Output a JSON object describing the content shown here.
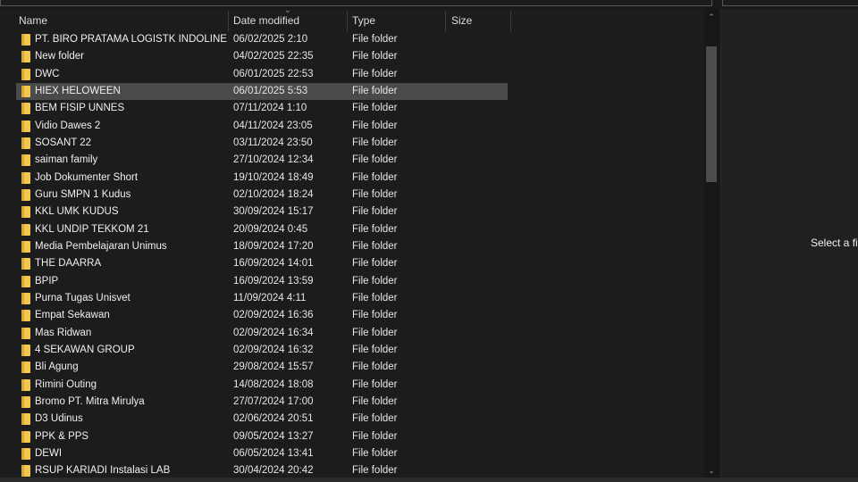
{
  "columns": {
    "name": "Name",
    "date": "Date modified",
    "type": "Type",
    "size": "Size"
  },
  "selected_index": 3,
  "rows": [
    {
      "name": "PT. BIRO PRATAMA LOGISTK INDOLINE",
      "date": "06/02/2025 2:10",
      "type": "File folder"
    },
    {
      "name": "New folder",
      "date": "04/02/2025 22:35",
      "type": "File folder"
    },
    {
      "name": "DWC",
      "date": "06/01/2025 22:53",
      "type": "File folder"
    },
    {
      "name": "HIEX HELOWEEN",
      "date": "06/01/2025 5:53",
      "type": "File folder"
    },
    {
      "name": "BEM FISIP UNNES",
      "date": "07/11/2024 1:10",
      "type": "File folder"
    },
    {
      "name": "Vidio Dawes 2",
      "date": "04/11/2024 23:05",
      "type": "File folder"
    },
    {
      "name": "SOSANT 22",
      "date": "03/11/2024 23:50",
      "type": "File folder"
    },
    {
      "name": "saiman family",
      "date": "27/10/2024 12:34",
      "type": "File folder"
    },
    {
      "name": "Job Dokumenter Short",
      "date": "19/10/2024 18:49",
      "type": "File folder"
    },
    {
      "name": "Guru SMPN 1 Kudus",
      "date": "02/10/2024 18:24",
      "type": "File folder"
    },
    {
      "name": "KKL UMK KUDUS",
      "date": "30/09/2024 15:17",
      "type": "File folder"
    },
    {
      "name": "KKL UNDIP TEKKOM 21",
      "date": "20/09/2024 0:45",
      "type": "File folder"
    },
    {
      "name": "Media Pembelajaran Unimus",
      "date": "18/09/2024 17:20",
      "type": "File folder"
    },
    {
      "name": "THE DAARRA",
      "date": "16/09/2024 14:01",
      "type": "File folder"
    },
    {
      "name": "BPIP",
      "date": "16/09/2024 13:59",
      "type": "File folder"
    },
    {
      "name": "Purna Tugas Unisvet",
      "date": "11/09/2024 4:11",
      "type": "File folder"
    },
    {
      "name": "Empat Sekawan",
      "date": "02/09/2024 16:36",
      "type": "File folder"
    },
    {
      "name": "Mas Ridwan",
      "date": "02/09/2024 16:34",
      "type": "File folder"
    },
    {
      "name": "4 SEKAWAN GROUP",
      "date": "02/09/2024 16:32",
      "type": "File folder"
    },
    {
      "name": "Bli Agung",
      "date": "29/08/2024 15:57",
      "type": "File folder"
    },
    {
      "name": "Rimini Outing",
      "date": "14/08/2024 18:08",
      "type": "File folder"
    },
    {
      "name": "Bromo PT. Mitra Mirulya",
      "date": "27/07/2024 17:00",
      "type": "File folder"
    },
    {
      "name": "D3 Udinus",
      "date": "02/06/2024 20:51",
      "type": "File folder"
    },
    {
      "name": "PPK & PPS",
      "date": "09/05/2024 13:27",
      "type": "File folder"
    },
    {
      "name": "DEWI",
      "date": "06/05/2024 13:41",
      "type": "File folder"
    },
    {
      "name": "RSUP KARIADI Instalasi LAB",
      "date": "30/04/2024 20:42",
      "type": "File folder"
    }
  ],
  "preview": {
    "message": "Select a file"
  },
  "colors": {
    "folder": "#f3c650",
    "selected_row": "#4a4a4a",
    "background": "#1c1c1c"
  }
}
